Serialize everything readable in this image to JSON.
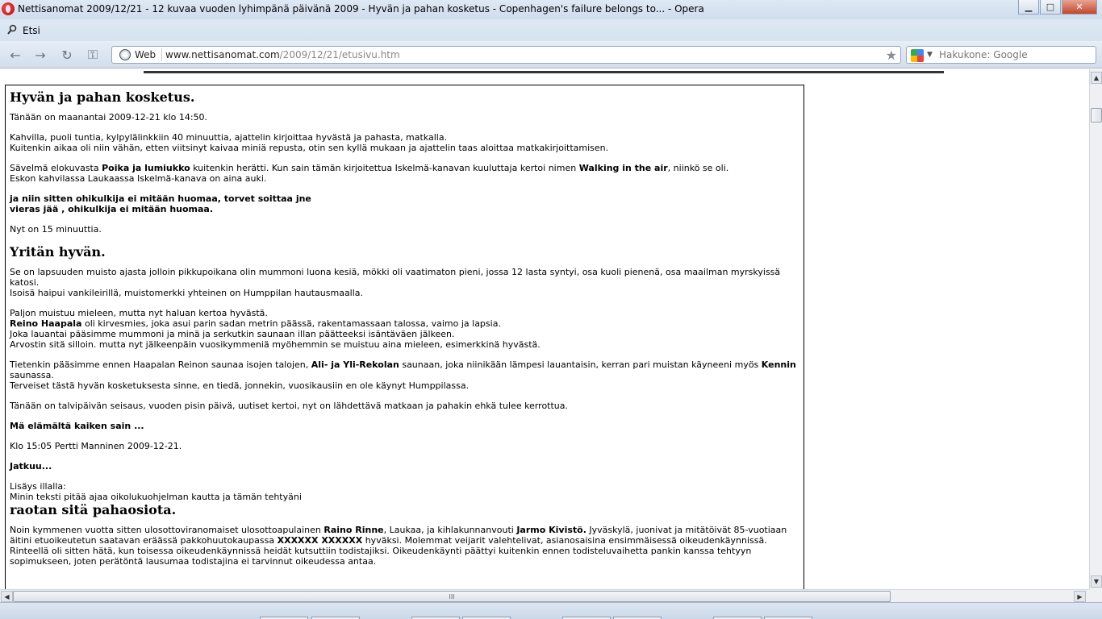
{
  "window": {
    "title": "Nettisanomat 2009/12/21 - 12 kuvaa vuoden lyhimpänä päivänä 2009 - Hyvän ja pahan kosketus - Copenhagen's failure belongs to... - Opera",
    "minimize": "▁",
    "maximize": "□",
    "close": "✕"
  },
  "findbar": {
    "label": "Etsi"
  },
  "toolbar": {
    "back": "←",
    "forward": "→",
    "reload": "↻",
    "key": "⚿",
    "badge": "Web",
    "url_host": "www.nettisanomat.com",
    "url_path": "/2009/12/21/etusivu.htm",
    "star": "★",
    "search_placeholder": "Hakukone: Google"
  },
  "article": {
    "h1": "Hyvän ja pahan kosketus.",
    "date_line": "Tänään on maanantai 2009-12-21 klo 14:50.",
    "p1_l1": "Kahvilla, puoli tuntia, kylpylälinkkiin 40 minuuttia, ajattelin kirjoittaa hyvästä ja pahasta, matkalla.",
    "p1_l2": "Kuitenkin aikaa oli niin vähän, etten viitsinyt kaivaa miniä repusta, otin sen kyllä mukaan ja ajattelin taas aloittaa matkakirjoittamisen.",
    "p2_a": "Sävelmä elokuvasta ",
    "p2_b": "Poika ja lumiukko",
    "p2_c": " kuitenkin herätti. Kun sain tämän kirjoitettua Iskelmä-kanavan kuuluttaja kertoi nimen ",
    "p2_d": "Walking in the air",
    "p2_e": ", niinkö se oli.",
    "p2_l2": "Eskon kahvilassa Laukaassa Iskelmä-kanava on aina auki.",
    "lyric1": "ja niin sitten ohikulkija ei mitään huomaa, torvet soittaa jne",
    "lyric2": "vieras jää , ohikulkija ei mitään huomaa.",
    "p3": "Nyt on 15 minuuttia.",
    "h2": "Yritän hyvän.",
    "p4_l1": "Se on lapsuuden muisto ajasta jolloin pikkupoikana olin mummoni luona kesiä, mökki oli vaatimaton pieni, jossa 12 lasta syntyi, osa kuoli pienenä, osa maailman myrskyissä katosi.",
    "p4_l2": "Isoisä haipui vankileirillä, muistomerkki yhteinen on Humppilan hautausmaalla.",
    "p5_l1": "Paljon muistuu mieleen, mutta nyt haluan kertoa hyvästä.",
    "p5_l2a": "Reino Haapala",
    "p5_l2b": " oli kirvesmies, joka asui parin sadan metrin päässä, rakentamassaan talossa, vaimo ja lapsia.",
    "p5_l3": "Joka lauantai pääsimme mummoni ja minä ja serkutkin saunaan illan päätteeksi isäntäväen jälkeen.",
    "p5_l4": "Arvostin sitä silloin. mutta nyt jälkeenpäin vuosikymmeniä myöhemmin se muistuu aina mieleen, esimerkkinä hyvästä.",
    "p6_a": "Tietenkin pääsimme ennen Haapalan Reinon saunaa isojen talojen, ",
    "p6_b": "Ali- ja Yli-Rekolan",
    "p6_c": " saunaan, joka niinikään lämpesi lauantaisin, kerran pari muistan käyneeni myös ",
    "p6_d": "Kennin",
    "p6_e": " saunassa.",
    "p6_l2": "Terveiset tästä hyvän kosketuksesta sinne, en tiedä, jonnekin, vuosikausiin en ole käynyt Humppilassa.",
    "p7": "Tänään on talvipäivän seisaus, vuoden pisin päivä, uutiset kertoi, nyt on lähdettävä matkaan ja pahakin ehkä tulee kerrottua.",
    "p8": "Mä elämältä kaiken sain ...",
    "p9": "Klo 15:05 Pertti Manninen 2009-12-21.",
    "p10": "Jatkuu...",
    "p11_l1": "Lisäys illalla:",
    "p11_l2": "Minin teksti pitää ajaa oikolukuohjelman kautta ja tämän tehtyäni",
    "h3": "raotan sitä pahaosiota.",
    "p12_a": "Noin kymmenen vuotta sitten ulosottoviranomaiset ulosottoapulainen ",
    "p12_b": "Raino Rinne",
    "p12_c": ", Laukaa, ja kihlakunnanvouti ",
    "p12_d": "Jarmo Kivistö.",
    "p12_e": " Jyväskylä, juonivat ja mitätöivät 85-vuotiaan äitini etuoikeutetun saatavan eräässä pakkohuutokaupassa ",
    "p12_f": "XXXXXX XXXXXX",
    "p12_g": " hyväksi. Molemmat veijarit valehtelivat, asianosaisina ensimmäisessä oikeudenkäynnissä. Rinteellä oli sitten hätä, kun toisessa oikeudenkäynnissä heidät kutsuttiin todistajiksi. Oikeudenkäynti päättyi kuitenkin ennen todisteluvaihetta pankin kanssa tehtyyn sopimukseen, joten perätöntä lausumaa todistajina ei tarvinnut oikeudessa antaa."
  },
  "scrollbar": {
    "grip": "III"
  }
}
